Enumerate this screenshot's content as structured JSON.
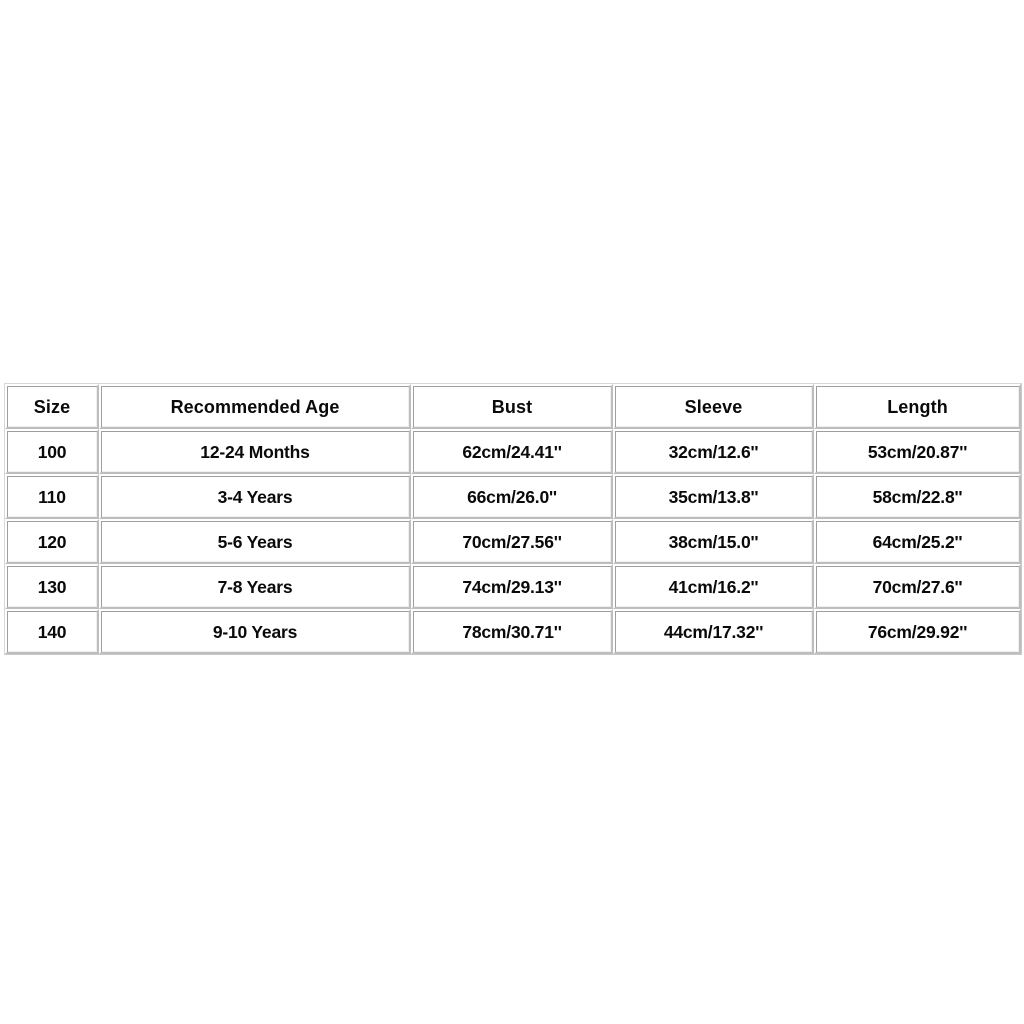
{
  "page": {
    "background_color": "#ffffff",
    "text_color": "#0a0a0a",
    "border_color": "#bdbdbd"
  },
  "size_chart": {
    "columns": [
      {
        "key": "size",
        "label": "Size"
      },
      {
        "key": "age",
        "label": "Recommended Age"
      },
      {
        "key": "bust",
        "label": "Bust"
      },
      {
        "key": "sleeve",
        "label": "Sleeve"
      },
      {
        "key": "length",
        "label": "Length"
      }
    ],
    "rows": [
      {
        "size": "100",
        "age": "12-24 Months",
        "bust": "62cm/24.41''",
        "sleeve": "32cm/12.6''",
        "length": "53cm/20.87''"
      },
      {
        "size": "110",
        "age": "3-4 Years",
        "bust": "66cm/26.0''",
        "sleeve": "35cm/13.8''",
        "length": "58cm/22.8''"
      },
      {
        "size": "120",
        "age": "5-6 Years",
        "bust": "70cm/27.56''",
        "sleeve": "38cm/15.0''",
        "length": "64cm/25.2''"
      },
      {
        "size": "130",
        "age": "7-8 Years",
        "bust": "74cm/29.13''",
        "sleeve": "41cm/16.2''",
        "length": "70cm/27.6''"
      },
      {
        "size": "140",
        "age": "9-10 Years",
        "bust": "78cm/30.71''",
        "sleeve": "44cm/17.32''",
        "length": "76cm/29.92''"
      }
    ]
  }
}
